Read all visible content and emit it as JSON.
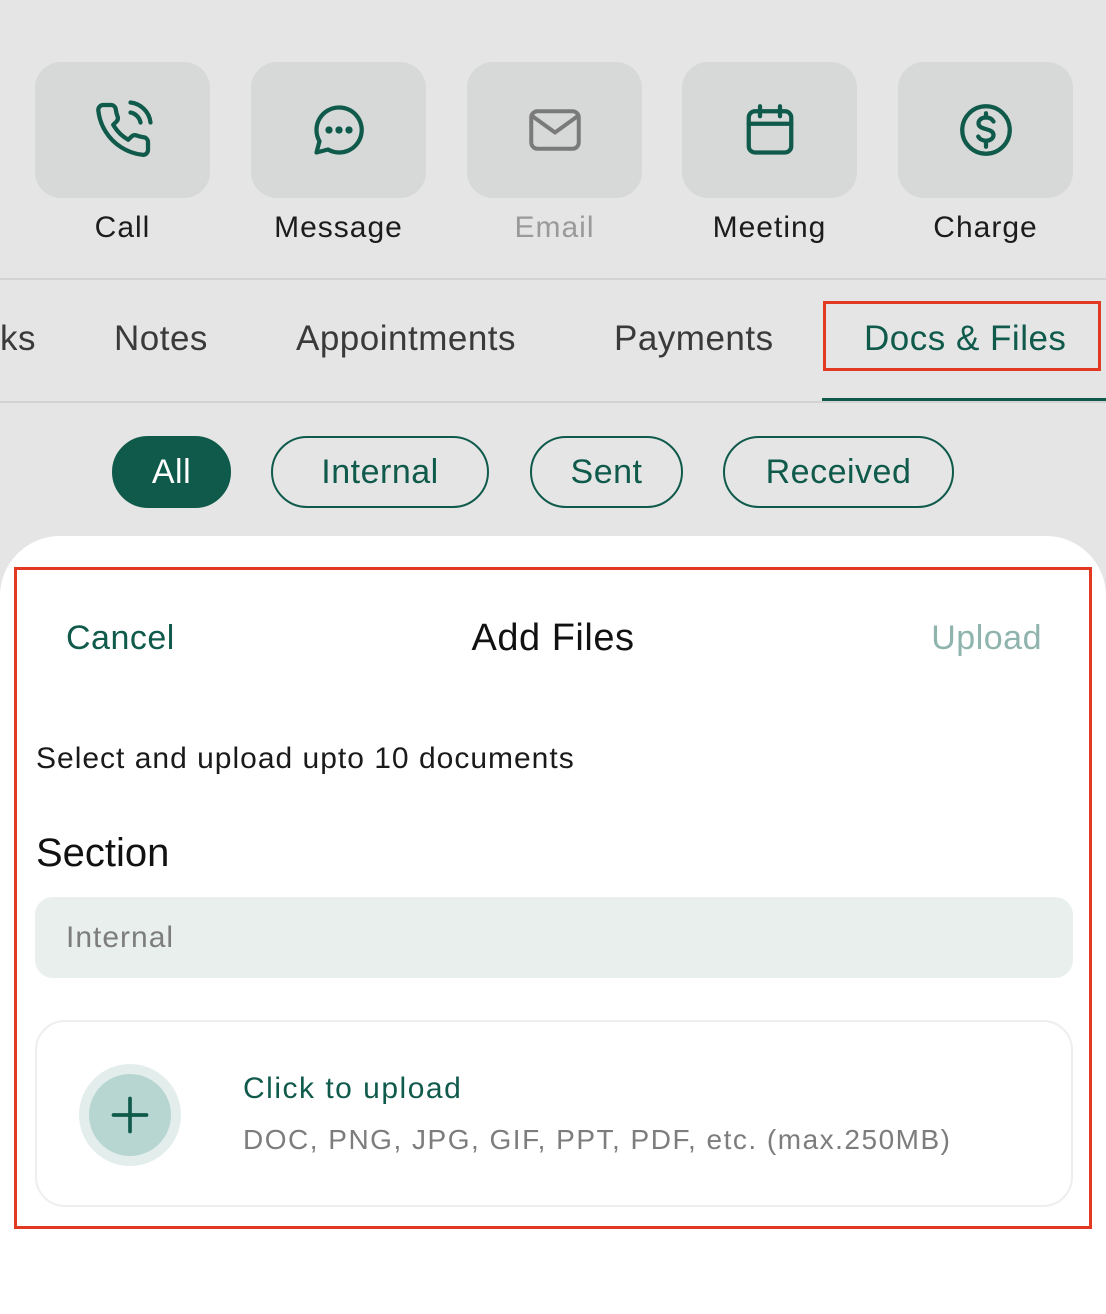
{
  "colors": {
    "accent": "#0f5a4b",
    "highlight": "#e23a22",
    "disabled_text": "#9a9a9a",
    "upload_disabled": "#8fb4ad"
  },
  "quick_actions": [
    {
      "label": "Call",
      "icon": "phone-icon",
      "enabled": true
    },
    {
      "label": "Message",
      "icon": "message-icon",
      "enabled": true
    },
    {
      "label": "Email",
      "icon": "mail-icon",
      "enabled": false
    },
    {
      "label": "Meeting",
      "icon": "calendar-icon",
      "enabled": true
    },
    {
      "label": "Charge",
      "icon": "dollar-icon",
      "enabled": true
    }
  ],
  "tabs": [
    {
      "label": "ks"
    },
    {
      "label": "Notes"
    },
    {
      "label": "Appointments"
    },
    {
      "label": "Payments"
    },
    {
      "label": "Docs & Files",
      "active": true
    }
  ],
  "filters": [
    {
      "label": "All",
      "selected": true
    },
    {
      "label": "Internal"
    },
    {
      "label": "Sent"
    },
    {
      "label": "Received"
    }
  ],
  "sheet": {
    "cancel_label": "Cancel",
    "title": "Add Files",
    "upload_label": "Upload",
    "instruction": "Select and upload upto 10 documents",
    "section_label": "Section",
    "section_value": "Internal",
    "upload_zone": {
      "icon": "plus-icon",
      "title": "Click to upload",
      "hint": "DOC, PNG, JPG, GIF, PPT, PDF, etc. (max.250MB)"
    }
  }
}
